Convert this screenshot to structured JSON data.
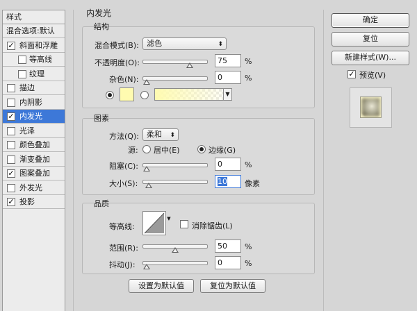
{
  "sidebar": {
    "header": "样式",
    "items": [
      {
        "label": "混合选项:默认",
        "checkbox": false,
        "checked": false,
        "sub": false,
        "selected": false
      },
      {
        "label": "斜面和浮雕",
        "checkbox": true,
        "checked": true,
        "sub": false,
        "selected": false
      },
      {
        "label": "等高线",
        "checkbox": true,
        "checked": false,
        "sub": true,
        "selected": false
      },
      {
        "label": "纹理",
        "checkbox": true,
        "checked": false,
        "sub": true,
        "selected": false
      },
      {
        "label": "描边",
        "checkbox": true,
        "checked": false,
        "sub": false,
        "selected": false
      },
      {
        "label": "内阴影",
        "checkbox": true,
        "checked": false,
        "sub": false,
        "selected": false
      },
      {
        "label": "内发光",
        "checkbox": true,
        "checked": true,
        "sub": false,
        "selected": true
      },
      {
        "label": "光泽",
        "checkbox": true,
        "checked": false,
        "sub": false,
        "selected": false
      },
      {
        "label": "颜色叠加",
        "checkbox": true,
        "checked": false,
        "sub": false,
        "selected": false
      },
      {
        "label": "渐变叠加",
        "checkbox": true,
        "checked": false,
        "sub": false,
        "selected": false
      },
      {
        "label": "图案叠加",
        "checkbox": true,
        "checked": true,
        "sub": false,
        "selected": false
      },
      {
        "label": "外发光",
        "checkbox": true,
        "checked": false,
        "sub": false,
        "selected": false
      },
      {
        "label": "投影",
        "checkbox": true,
        "checked": true,
        "sub": false,
        "selected": false
      }
    ]
  },
  "panel": {
    "title": "内发光",
    "structure": {
      "title": "结构",
      "blend_mode_label": "混合模式(B):",
      "blend_mode_value": "滤色",
      "opacity_label": "不透明度(O):",
      "opacity_value": "75",
      "opacity_fraction": 0.75,
      "noise_label": "杂色(N):",
      "noise_value": "0",
      "noise_fraction": 0.0,
      "percent": "%",
      "color_swatch": "#fffbb0"
    },
    "elements": {
      "title": "图素",
      "technique_label": "方法(Q):",
      "technique_value": "柔和",
      "source_label": "源:",
      "center_label": "居中(E)",
      "edge_label": "边缘(G)",
      "choke_label": "阻塞(C):",
      "choke_value": "0",
      "choke_fraction": 0.0,
      "size_label": "大小(S):",
      "size_value": "10",
      "size_fraction": 0.04,
      "percent": "%",
      "pixels": "像素"
    },
    "quality": {
      "title": "品质",
      "contour_label": "等高线:",
      "antialias_label": "消除锯齿(L)",
      "range_label": "范围(R):",
      "range_value": "50",
      "range_fraction": 0.5,
      "jitter_label": "抖动(J):",
      "jitter_value": "0",
      "jitter_fraction": 0.0,
      "percent": "%"
    },
    "make_default_label": "设置为默认值",
    "reset_default_label": "复位为默认值"
  },
  "buttons": {
    "ok": "确定",
    "reset": "复位",
    "new_style": "新建样式(W)...",
    "preview_label": "预览(V)",
    "preview_checked": true
  },
  "colors": {
    "selected": "#3d78d8",
    "panel_bg": "#d6d6d6"
  }
}
